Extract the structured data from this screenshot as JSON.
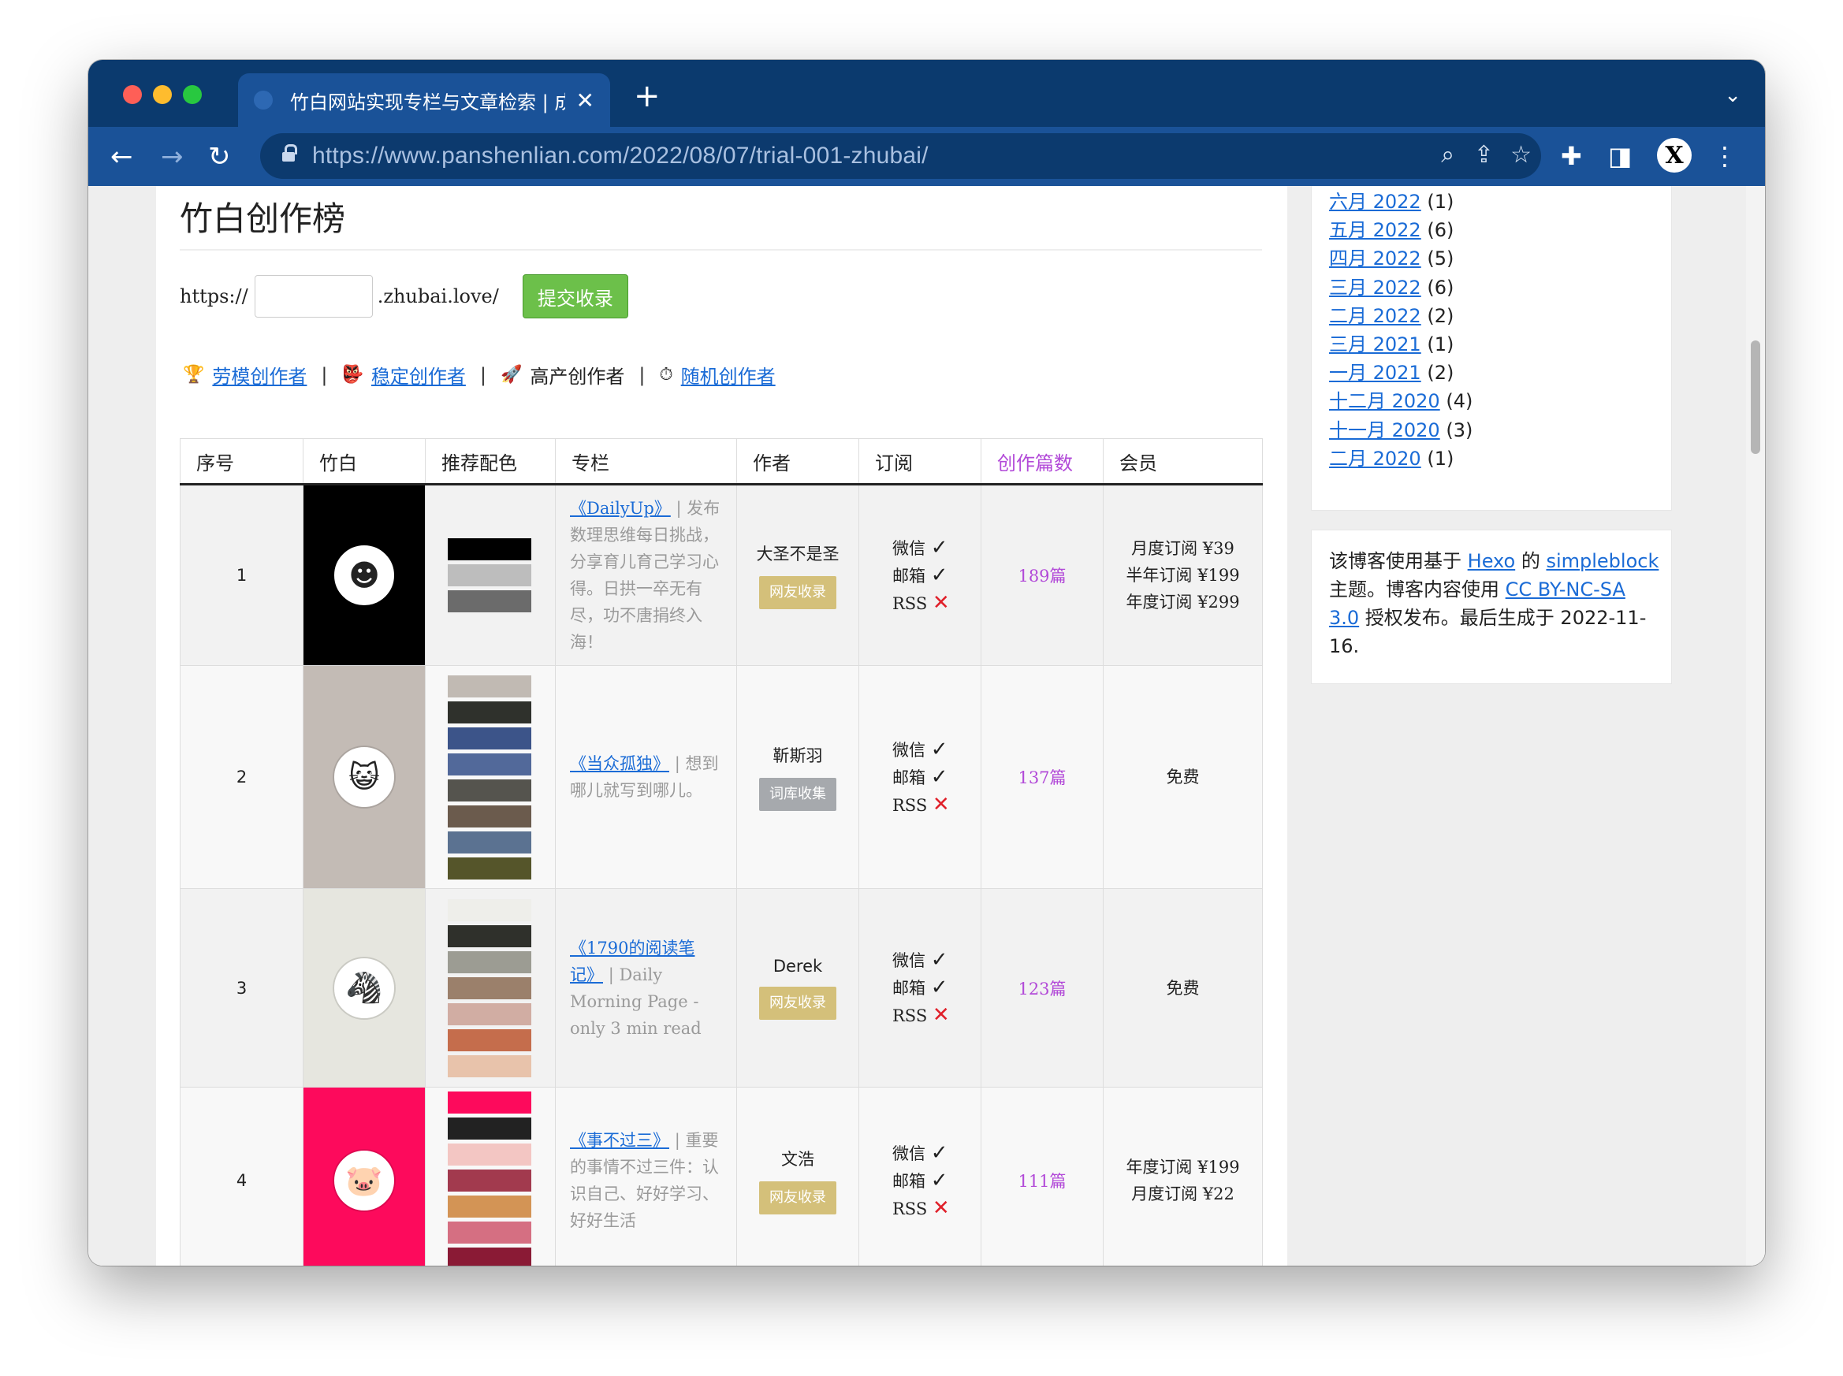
{
  "browser": {
    "tab_title": "竹白网站实现专栏与文章检索 | 成",
    "new_tab_label": "+",
    "url_host": "https://www.panshenlian.com",
    "url_path": "/2022/08/07/trial-001-zhubai/",
    "profile_initial": "X"
  },
  "page": {
    "title": "竹白创作榜",
    "form": {
      "prefix": "https://",
      "input_value": "",
      "suffix": ".zhubai.love/",
      "submit_label": "提交收录"
    },
    "categories": [
      {
        "icon": "🏆",
        "label": "劳模创作者",
        "link": true
      },
      {
        "icon": "👺",
        "label": "稳定创作者",
        "link": true
      },
      {
        "icon": "🚀",
        "label": "高产创作者",
        "link": false
      },
      {
        "icon": "⏱",
        "label": "随机创作者",
        "link": true
      }
    ],
    "separator": "|",
    "table": {
      "headers": [
        "序号",
        "竹白",
        "推荐配色",
        "专栏",
        "作者",
        "订阅",
        "创作篇数",
        "会员"
      ],
      "rows": [
        {
          "index": "1",
          "bg": "#000000",
          "avatar_icon": "bearded-man-icon",
          "avatar_glyph": "☻",
          "swatches": [
            "#000000",
            "#bdbdbd",
            "#6b6b6b"
          ],
          "column_title": "《DailyUp》",
          "column_desc": "| 发布数理思维每日挑战，分享育儿育己学习心得。日拱一卒无有尽，功不唐捐终入海！",
          "author": "大圣不是圣",
          "badge": "网友收录",
          "badge_type": "gold",
          "sub_wechat": "微信",
          "sub_mail": "邮箱",
          "sub_rss": "RSS",
          "count": "189篇",
          "member": [
            "月度订阅 ¥39",
            "半年订阅 ¥199",
            "年度订阅 ¥299"
          ]
        },
        {
          "index": "2",
          "bg": "#c3bbb5",
          "avatar_icon": "cat-icon",
          "avatar_glyph": "😺",
          "swatches": [
            "#c1bab3",
            "#2f312c",
            "#3c5489",
            "#52699a",
            "#55544e",
            "#6b5b4d",
            "#5b7291",
            "#55552a"
          ],
          "column_title": "《当众孤独》",
          "column_desc": "| 想到哪儿就写到哪儿。",
          "author": "靳斯羽",
          "badge": "词库收集",
          "badge_type": "grey",
          "sub_wechat": "微信",
          "sub_mail": "邮箱",
          "sub_rss": "RSS",
          "count": "137篇",
          "member": [
            "免费"
          ]
        },
        {
          "index": "3",
          "bg": "#e6e6df",
          "avatar_icon": "zebra-icon",
          "avatar_glyph": "🦓",
          "swatches": [
            "#eeeeea",
            "#2f302b",
            "#9c9c93",
            "#9b806b",
            "#d1ada3",
            "#c56d4c",
            "#e8c3ab"
          ],
          "column_title": "《1790的阅读笔记》",
          "column_desc": "| Daily Morning Page - only 3 min read",
          "author": "Derek",
          "badge": "网友收录",
          "badge_type": "gold",
          "sub_wechat": "微信",
          "sub_mail": "邮箱",
          "sub_rss": "RSS",
          "count": "123篇",
          "member": [
            "免费"
          ]
        },
        {
          "index": "4",
          "bg": "#fd0a5c",
          "avatar_icon": "pig-icon",
          "avatar_glyph": "🐷",
          "swatches": [
            "#fd0a5c",
            "#222222",
            "#f3c6c3",
            "#a23a4e",
            "#d39455",
            "#d56f82",
            "#8a1a35"
          ],
          "column_title": "《事不过三》",
          "column_desc": "| 重要的事情不过三件：认识自己、好好学习、好好生活",
          "author": "文浩",
          "badge": "网友收录",
          "badge_type": "gold",
          "sub_wechat": "微信",
          "sub_mail": "邮箱",
          "sub_rss": "RSS",
          "count": "111篇",
          "member": [
            "年度订阅 ¥199",
            "月度订阅 ¥22"
          ]
        }
      ]
    }
  },
  "sidebar": {
    "archives": [
      {
        "label": "六月 2022",
        "count": "(1)"
      },
      {
        "label": "五月 2022",
        "count": "(6)"
      },
      {
        "label": "四月 2022",
        "count": "(5)"
      },
      {
        "label": "三月 2022",
        "count": "(6)"
      },
      {
        "label": "二月 2022",
        "count": "(2)"
      },
      {
        "label": "三月 2021",
        "count": "(1)"
      },
      {
        "label": "一月 2021",
        "count": "(2)"
      },
      {
        "label": "十二月 2020",
        "count": "(4)"
      },
      {
        "label": "十一月 2020",
        "count": "(3)"
      },
      {
        "label": "二月 2020",
        "count": "(1)"
      }
    ],
    "info": {
      "t1": "该博客使用基于 ",
      "hexo": "Hexo",
      "t2": " 的 ",
      "theme": "simpleblock",
      "t3": " 主题。博客内容使用 ",
      "license": "CC BY-NC-SA 3.0",
      "t4": " 授权发布。最后生成于 2022-11-16."
    }
  },
  "colors": {
    "tabstrip": "#0b3a6e",
    "toolbar": "#1a5298",
    "link": "#1a6bd6",
    "accent": "#b24ad8",
    "submit": "#6cc04a"
  }
}
